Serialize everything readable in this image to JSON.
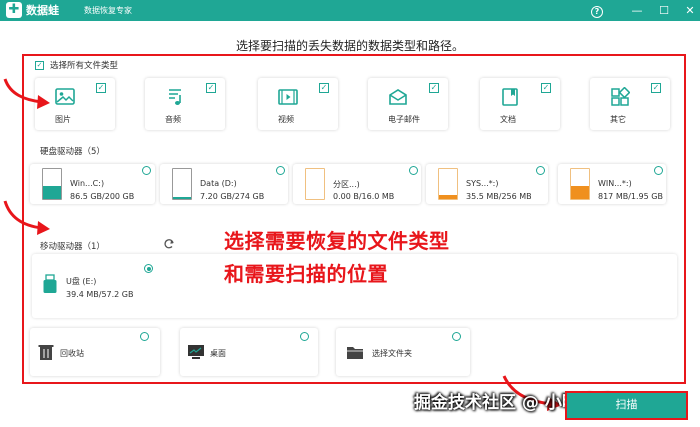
{
  "app": {
    "logo_char": "✚",
    "name": "数据蛙",
    "subtitle": "数据恢复专家"
  },
  "window_buttons": {
    "help": "?",
    "minimize": "—",
    "maximize": "☐",
    "close": "✕"
  },
  "headline": "选择要扫描的丢失数据的数据类型和路径。",
  "select_all": {
    "label": "选择所有文件类型",
    "checked": true
  },
  "file_types": [
    {
      "label": "图片",
      "icon": "image-icon",
      "checked": true
    },
    {
      "label": "音频",
      "icon": "music-icon",
      "checked": true
    },
    {
      "label": "视频",
      "icon": "video-icon",
      "checked": true
    },
    {
      "label": "电子邮件",
      "icon": "email-icon",
      "checked": true
    },
    {
      "label": "文档",
      "icon": "document-icon",
      "checked": true
    },
    {
      "label": "其它",
      "icon": "other-icon",
      "checked": true
    }
  ],
  "hard_drives": {
    "label": "硬盘驱动器（5）",
    "items": [
      {
        "name": "Win...C:)",
        "size": "86.5 GB/200 GB",
        "usage": 0.43,
        "color": "#1fa795",
        "selected": false
      },
      {
        "name": "Data (D:)",
        "size": "7.20 GB/274 GB",
        "usage": 0.03,
        "color": "#1fa795",
        "selected": false
      },
      {
        "name": "分区...)",
        "size": "0.00 B/16.0 MB",
        "usage": 0.0,
        "color": "#f0901e",
        "selected": false
      },
      {
        "name": "SYS...*:)",
        "size": "35.5 MB/256 MB",
        "usage": 0.14,
        "color": "#f0901e",
        "selected": false
      },
      {
        "name": "WIN...*:)",
        "size": "817 MB/1.95 GB",
        "usage": 0.42,
        "color": "#f0901e",
        "selected": false
      }
    ]
  },
  "removable_drives": {
    "label": "移动驱动器（1）",
    "items": [
      {
        "name": "U盘 (E:)",
        "size": "39.4 MB/57.2 GB",
        "selected": true
      }
    ]
  },
  "locations": [
    {
      "label": "回收站",
      "icon": "recycle-bin-icon"
    },
    {
      "label": "桌面",
      "icon": "desktop-icon"
    },
    {
      "label": "选择文件夹",
      "icon": "folder-icon"
    }
  ],
  "overlay_text": [
    "选择需要恢复的文件类型",
    "和需要扫描的位置"
  ],
  "watermark": "掘金技术社区 @ 小明助手",
  "start_button": "扫描",
  "colors": {
    "accent": "#1fa795",
    "annotation": "#e8161b",
    "warning": "#f0901e"
  }
}
